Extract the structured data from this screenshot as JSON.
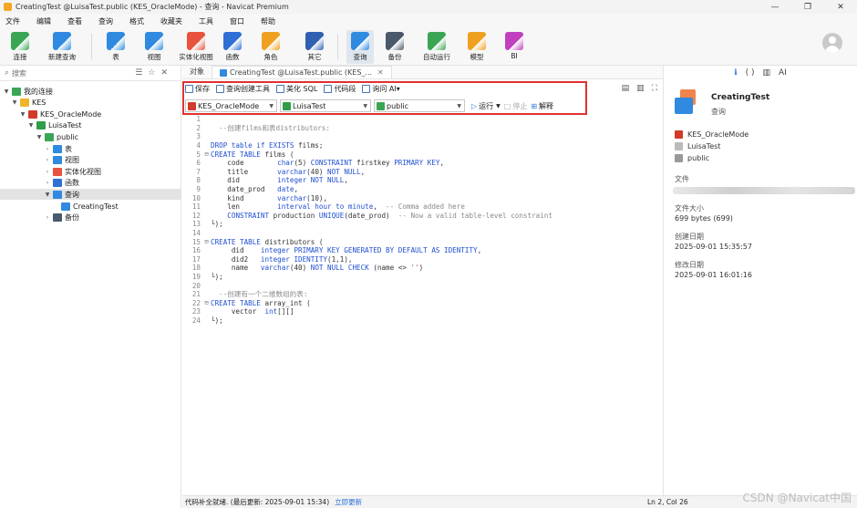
{
  "window": {
    "title": "CreatingTest @LuisaTest.public (KES_OracleMode) - 查询 - Navicat Premium",
    "controls": [
      "—",
      "❐",
      "✕"
    ]
  },
  "menu": [
    "文件",
    "编辑",
    "查看",
    "查询",
    "格式",
    "收藏夹",
    "工具",
    "窗口",
    "帮助"
  ],
  "toolbar": [
    {
      "label": "连接",
      "icon": "connection-icon",
      "color": "#3aa655"
    },
    {
      "label": "新建查询",
      "icon": "new-query-icon",
      "color": "#2f8ae0"
    },
    {
      "label": "表",
      "icon": "table-icon",
      "color": "#2f8ae0"
    },
    {
      "label": "视图",
      "icon": "view-icon",
      "color": "#2f8ae0"
    },
    {
      "label": "实体化视图",
      "icon": "materialized-view-icon",
      "color": "#e8533f"
    },
    {
      "label": "函数",
      "icon": "function-icon",
      "color": "#2f6fd6"
    },
    {
      "label": "角色",
      "icon": "role-icon",
      "color": "#f0a020"
    },
    {
      "label": "其它",
      "icon": "other-icon",
      "color": "#3060b0"
    },
    {
      "label": "查询",
      "icon": "query-icon",
      "color": "#2f8ae0"
    },
    {
      "label": "备份",
      "icon": "backup-icon",
      "color": "#4a5a6a"
    },
    {
      "label": "自动运行",
      "icon": "automation-icon",
      "color": "#3aa655"
    },
    {
      "label": "模型",
      "icon": "model-icon",
      "color": "#f0a020"
    },
    {
      "label": "BI",
      "icon": "bi-icon",
      "color": "#c040c0"
    }
  ],
  "search": {
    "placeholder": "搜索",
    "tools": [
      "☰",
      "☆",
      "✕"
    ]
  },
  "tree": [
    {
      "label": "我的连接",
      "depth": 0,
      "caret": "▼",
      "icon": "my-connections-icon",
      "color": "#3aa655"
    },
    {
      "label": "KES",
      "depth": 1,
      "caret": "▼",
      "icon": "folder-icon",
      "color": "#f0b429"
    },
    {
      "label": "KES_OracleMode",
      "depth": 2,
      "caret": "▼",
      "icon": "kes-connection-icon",
      "color": "#d23a2a"
    },
    {
      "label": "LuisaTest",
      "depth": 3,
      "caret": "▼",
      "icon": "database-icon",
      "color": "#2e9e48"
    },
    {
      "label": "public",
      "depth": 4,
      "caret": "▼",
      "icon": "schema-icon",
      "color": "#3aa655"
    },
    {
      "label": "表",
      "depth": 5,
      "caret": "›",
      "icon": "table-icon",
      "color": "#2f8ae0"
    },
    {
      "label": "视图",
      "depth": 5,
      "caret": "›",
      "icon": "view-icon",
      "color": "#2f8ae0"
    },
    {
      "label": "实体化视图",
      "depth": 5,
      "caret": "›",
      "icon": "materialized-view-icon",
      "color": "#e8533f"
    },
    {
      "label": "函数",
      "depth": 5,
      "caret": "›",
      "icon": "function-icon",
      "color": "#2f6fd6"
    },
    {
      "label": "查询",
      "depth": 5,
      "caret": "▼",
      "icon": "query-icon",
      "color": "#2f8ae0",
      "selected": true
    },
    {
      "label": "CreatingTest",
      "depth": 6,
      "caret": "",
      "icon": "query-item-icon",
      "color": "#2f8ae0"
    },
    {
      "label": "备份",
      "depth": 5,
      "caret": "›",
      "icon": "backup-icon",
      "color": "#4a5a6a"
    }
  ],
  "tabs": {
    "objects": "对象",
    "active": "CreatingTest @LuisaTest.public (KES_...",
    "close": "✕"
  },
  "query_toolbar": [
    {
      "label": "保存",
      "icon": "save-icon"
    },
    {
      "label": "查询创建工具",
      "icon": "query-builder-icon"
    },
    {
      "label": "美化 SQL",
      "icon": "beautify-sql-icon"
    },
    {
      "label": "代码段",
      "icon": "code-snippet-icon"
    },
    {
      "label": "询问 AI",
      "icon": "ask-ai-icon"
    }
  ],
  "selectors": {
    "connection": "KES_OracleMode",
    "database": "LuisaTest",
    "schema": "public",
    "run": "运行",
    "stop": "停止",
    "explain": "解释"
  },
  "code_lines": [
    {
      "n": "1",
      "fold": "",
      "parts": [
        [
          "",
          ""
        ]
      ]
    },
    {
      "n": "2",
      "fold": "",
      "parts": [
        [
          "cm",
          "  --创建films和表distributors:"
        ]
      ]
    },
    {
      "n": "3",
      "fold": "",
      "parts": [
        [
          "",
          ""
        ]
      ]
    },
    {
      "n": "4",
      "fold": "",
      "parts": [
        [
          "kw",
          "DROP table if EXISTS "
        ],
        [
          "",
          "films;"
        ]
      ]
    },
    {
      "n": "5",
      "fold": "⊟",
      "parts": [
        [
          "kw",
          "CREATE TABLE "
        ],
        [
          "",
          "films ("
        ]
      ]
    },
    {
      "n": "6",
      "fold": "",
      "parts": [
        [
          "",
          "    code        "
        ],
        [
          "kw",
          "char"
        ],
        [
          "",
          "(5) "
        ],
        [
          "kw",
          "CONSTRAINT "
        ],
        [
          "",
          "firstkey "
        ],
        [
          "kw",
          "PRIMARY KEY"
        ],
        [
          "",
          ","
        ]
      ]
    },
    {
      "n": "7",
      "fold": "",
      "parts": [
        [
          "",
          "    title       "
        ],
        [
          "kw",
          "varchar"
        ],
        [
          "",
          "(40) "
        ],
        [
          "kw",
          "NOT NULL"
        ],
        [
          "",
          ","
        ]
      ]
    },
    {
      "n": "8",
      "fold": "",
      "parts": [
        [
          "",
          "    did         "
        ],
        [
          "kw",
          "integer NOT NULL"
        ],
        [
          "",
          ","
        ]
      ]
    },
    {
      "n": "9",
      "fold": "",
      "parts": [
        [
          "",
          "    date_prod   "
        ],
        [
          "kw",
          "date"
        ],
        [
          "",
          ","
        ]
      ]
    },
    {
      "n": "10",
      "fold": "",
      "parts": [
        [
          "",
          "    kind        "
        ],
        [
          "kw",
          "varchar"
        ],
        [
          "",
          "(10),"
        ]
      ]
    },
    {
      "n": "11",
      "fold": "",
      "parts": [
        [
          "",
          "    len         "
        ],
        [
          "kw",
          "interval hour to minute"
        ],
        [
          "",
          ",  "
        ],
        [
          "cm",
          "-- Comma added here"
        ]
      ]
    },
    {
      "n": "12",
      "fold": "",
      "parts": [
        [
          "",
          "    "
        ],
        [
          "kw",
          "CONSTRAINT "
        ],
        [
          "",
          "production "
        ],
        [
          "kw",
          "UNIQUE"
        ],
        [
          "",
          "(date_prod)  "
        ],
        [
          "cm",
          "-- Now a valid table-level constraint"
        ]
      ]
    },
    {
      "n": "13",
      "fold": "",
      "parts": [
        [
          "",
          "└);"
        ]
      ]
    },
    {
      "n": "14",
      "fold": "",
      "parts": [
        [
          "",
          ""
        ]
      ]
    },
    {
      "n": "15",
      "fold": "⊟",
      "parts": [
        [
          "kw",
          "CREATE TABLE "
        ],
        [
          "",
          "distributors ("
        ]
      ]
    },
    {
      "n": "16",
      "fold": "",
      "parts": [
        [
          "",
          "     did    "
        ],
        [
          "kw",
          "integer PRIMARY KEY GENERATED BY DEFAULT AS IDENTITY"
        ],
        [
          "",
          ","
        ]
      ]
    },
    {
      "n": "17",
      "fold": "",
      "parts": [
        [
          "",
          "     did2   "
        ],
        [
          "kw",
          "integer IDENTITY"
        ],
        [
          "",
          "(1,1),"
        ]
      ]
    },
    {
      "n": "18",
      "fold": "",
      "parts": [
        [
          "",
          "     name   "
        ],
        [
          "kw",
          "varchar"
        ],
        [
          "",
          "(40) "
        ],
        [
          "kw",
          "NOT NULL CHECK "
        ],
        [
          "",
          "(name <> "
        ],
        [
          "str",
          "''"
        ],
        [
          "",
          ")"
        ]
      ]
    },
    {
      "n": "19",
      "fold": "",
      "parts": [
        [
          "",
          "└);"
        ]
      ]
    },
    {
      "n": "20",
      "fold": "",
      "parts": [
        [
          "",
          ""
        ]
      ]
    },
    {
      "n": "21",
      "fold": "",
      "parts": [
        [
          "cm",
          "  --创建有一个二维数组的表:"
        ]
      ]
    },
    {
      "n": "22",
      "fold": "⊟",
      "parts": [
        [
          "kw",
          "CREATE TABLE "
        ],
        [
          "",
          "array_int ("
        ]
      ]
    },
    {
      "n": "23",
      "fold": "",
      "parts": [
        [
          "",
          "     vector  "
        ],
        [
          "kw",
          "int"
        ],
        [
          "",
          "[][]"
        ]
      ]
    },
    {
      "n": "24",
      "fold": "",
      "parts": [
        [
          "",
          "└);"
        ]
      ]
    }
  ],
  "status": {
    "text": "代码补全就绪. (最后更新: 2025-09-01 15:34)",
    "link": "立即更新",
    "position": "Ln 2, Col 26"
  },
  "right_panel": {
    "tools": [
      "ℹ",
      "( )",
      "▥",
      "AI"
    ],
    "name": "CreatingTest",
    "type": "查询",
    "connection": "KES_OracleMode",
    "database": "LuisaTest",
    "schema": "public",
    "file_label": "文件",
    "size_label": "文件大小",
    "size_value": "699 bytes (699)",
    "created_label": "创建日期",
    "created_value": "2025-09-01 15:35:57",
    "modified_label": "修改日期",
    "modified_value": "2025-09-01 16:01:16"
  },
  "watermark": "CSDN @Navicat中国"
}
